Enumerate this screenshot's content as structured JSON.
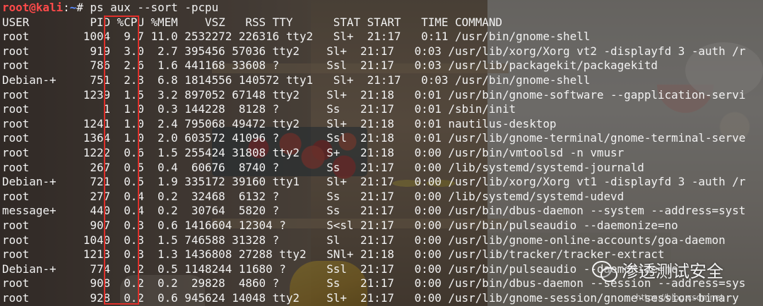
{
  "prompt": {
    "user_host": "root@kali",
    "separator": ":",
    "path": "~",
    "symbol": "# ",
    "command": "ps aux --sort -pcpu"
  },
  "header": "USER         PID %CPU %MEM    VSZ   RSS TTY      STAT START   TIME COMMAND",
  "rows": [
    "root        1004  9.7 11.0 2532272 226316 tty2   Sl+  21:17   0:11 /usr/bin/gnome-shell",
    "root         919  3.0  2.7 395456 57036 tty2    Sl+  21:17   0:03 /usr/lib/xorg/Xorg vt2 -displayfd 3 -auth /r",
    "root         786  2.6  1.6 441168 33608 ?       Ssl  21:17   0:03 /usr/lib/packagekit/packagekitd",
    "Debian-+     751  2.3  6.8 1814556 140572 tty1   Sl+  21:17   0:03 /usr/bin/gnome-shell",
    "root        1239  1.5  3.2 897052 67148 tty2    Sl+  21:18   0:01 /usr/bin/gnome-software --gapplication-servi",
    "root           1  1.0  0.3 144228  8128 ?       Ss   21:17   0:01 /sbin/init",
    "root        1241  1.0  2.4 795068 49472 tty2    Sl+  21:18   0:01 nautilus-desktop",
    "root        1364  1.0  2.0 603572 41096 ?       Ssl  21:18   0:01 /usr/lib/gnome-terminal/gnome-terminal-serve",
    "root        1222  0.6  1.5 255424 31808 tty2    S+   21:18   0:00 /usr/bin/vmtoolsd -n vmusr",
    "root         267  0.5  0.4  60676  8740 ?       Ss   21:17   0:00 /lib/systemd/systemd-journald",
    "Debian-+     721  0.5  1.9 335172 39160 tty1    Sl+  21:17   0:00 /usr/lib/xorg/Xorg vt1 -displayfd 3 -auth /r",
    "root         277  0.4  0.2  32468  6132 ?       Ss   21:17   0:00 /lib/systemd/systemd-udevd",
    "message+     440  0.4  0.2  30764  5820 ?       Ss   21:17   0:00 /usr/bin/dbus-daemon --system --address=syst",
    "root         907  0.3  0.6 1416604 12304 ?      S<sl 21:17   0:00 /usr/bin/pulseaudio --daemonize=no",
    "root        1040  0.3  1.5 746588 31328 ?       Sl   21:17   0:00 /usr/lib/gnome-online-accounts/goa-daemon",
    "root        1213  0.3  1.3 1436808 27288 tty2   SNl+ 21:18   0:00 /usr/lib/tracker/tracker-extract",
    "Debian-+     774  0.2  0.5 1148244 11680 ?      Ssl  21:17   0:00 /usr/bin/pulseaudio --daemonize=no",
    "root         908  0.2  0.2  29828  4860 ?       Ss   21:17   0:00 /usr/bin/dbus-daemon --session --address=sys",
    "root         928  0.2  0.6 945624 14048 tty2    Sl+  21:17   0:00 /usr/lib/gnome-session/gnome-session-binary"
  ],
  "watermark": {
    "label": "渗透测试安全",
    "sub": "https://blog.csdn.net",
    "icon": "wechat-icon"
  },
  "colors": {
    "prompt_user": "#ff4a4a",
    "prompt_path": "#5c8cff",
    "highlight_box": "#e0302b",
    "text": "#f2f2f2"
  }
}
